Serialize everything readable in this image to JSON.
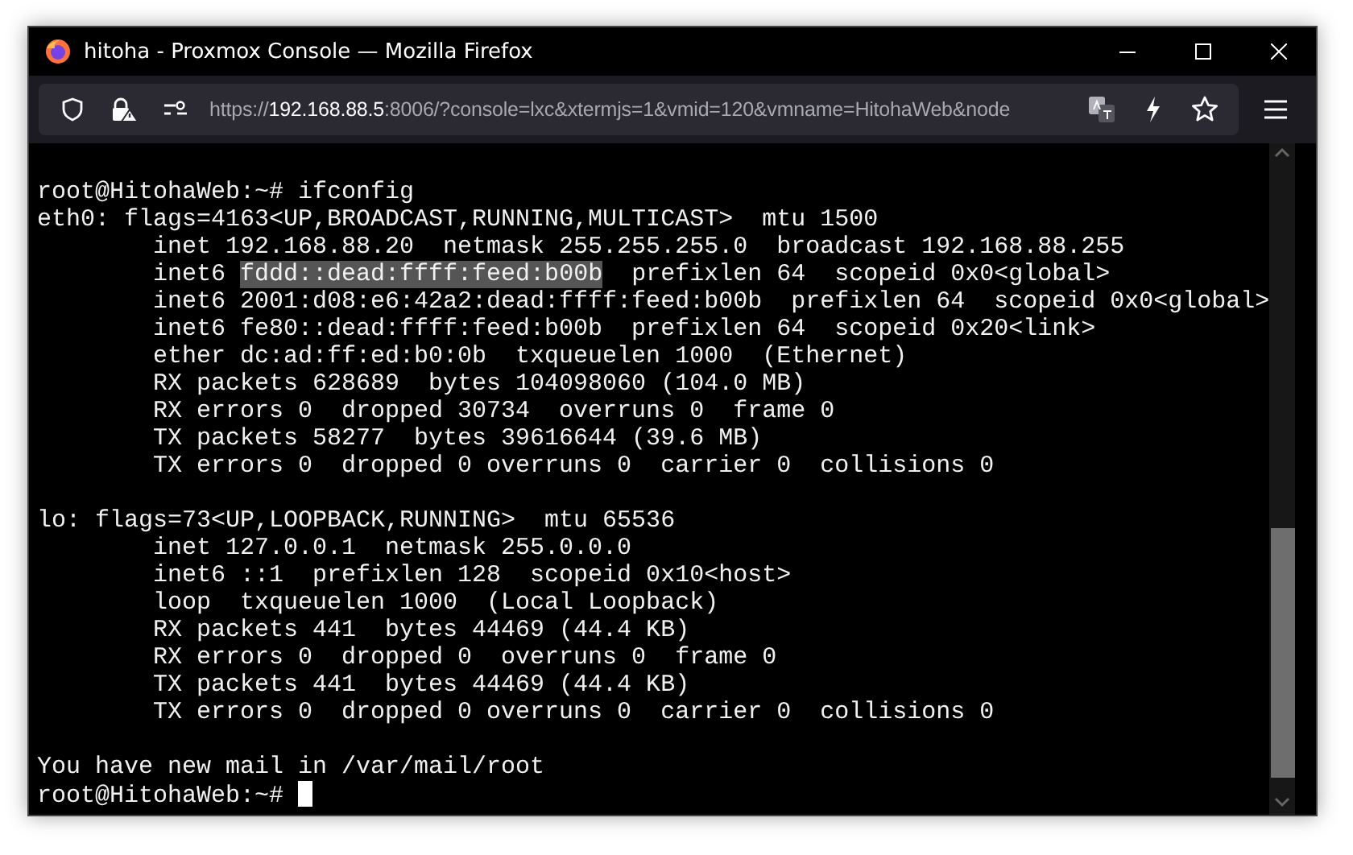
{
  "window": {
    "title": "hitoha - Proxmox Console — Mozilla Firefox"
  },
  "address_bar": {
    "scheme": "https://",
    "host": "192.168.88.5",
    "rest": ":8006/?console=lxc&xtermjs=1&vmid=120&vmname=HitohaWeb&node"
  },
  "terminal": {
    "lines": [
      {
        "kind": "blank"
      },
      [
        {
          "text": "root@HitohaWeb:~# ifconfig"
        }
      ],
      [
        {
          "text": "eth0: flags=4163<UP,BROADCAST,RUNNING,MULTICAST>  mtu 1500"
        }
      ],
      [
        {
          "text": "        inet 192.168.88.20  netmask 255.255.255.0  broadcast 192.168.88.255"
        }
      ],
      [
        {
          "text": "        inet6 "
        },
        {
          "text": "fddd::dead:ffff:feed:b00b",
          "selected": true
        },
        {
          "text": "  prefixlen 64  scopeid 0x0<global>"
        }
      ],
      [
        {
          "text": "        inet6 2001:d08:e6:42a2:dead:ffff:feed:b00b  prefixlen 64  scopeid 0x0<global>"
        }
      ],
      [
        {
          "text": "        inet6 fe80::dead:ffff:feed:b00b  prefixlen 64  scopeid 0x20<link>"
        }
      ],
      [
        {
          "text": "        ether dc:ad:ff:ed:b0:0b  txqueuelen 1000  (Ethernet)"
        }
      ],
      [
        {
          "text": "        RX packets 628689  bytes 104098060 (104.0 MB)"
        }
      ],
      [
        {
          "text": "        RX errors 0  dropped 30734  overruns 0  frame 0"
        }
      ],
      [
        {
          "text": "        TX packets 58277  bytes 39616644 (39.6 MB)"
        }
      ],
      [
        {
          "text": "        TX errors 0  dropped 0 overruns 0  carrier 0  collisions 0"
        }
      ],
      {
        "kind": "blank"
      },
      [
        {
          "text": "lo: flags=73<UP,LOOPBACK,RUNNING>  mtu 65536"
        }
      ],
      [
        {
          "text": "        inet 127.0.0.1  netmask 255.0.0.0"
        }
      ],
      [
        {
          "text": "        inet6 ::1  prefixlen 128  scopeid 0x10<host>"
        }
      ],
      [
        {
          "text": "        loop  txqueuelen 1000  (Local Loopback)"
        }
      ],
      [
        {
          "text": "        RX packets 441  bytes 44469 (44.4 KB)"
        }
      ],
      [
        {
          "text": "        RX errors 0  dropped 0  overruns 0  frame 0"
        }
      ],
      [
        {
          "text": "        TX packets 441  bytes 44469 (44.4 KB)"
        }
      ],
      [
        {
          "text": "        TX errors 0  dropped 0 overruns 0  carrier 0  collisions 0"
        }
      ],
      {
        "kind": "blank"
      },
      [
        {
          "text": "You have new mail in /var/mail/root"
        }
      ],
      [
        {
          "text": "root@HitohaWeb:~# "
        },
        {
          "kind": "cursor"
        }
      ]
    ]
  }
}
